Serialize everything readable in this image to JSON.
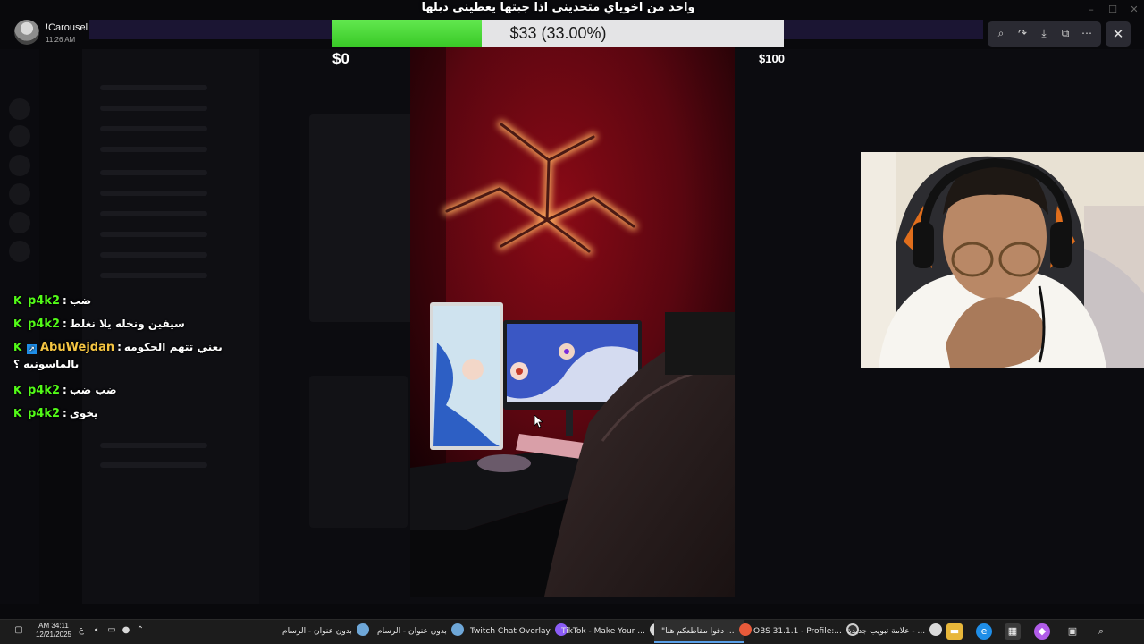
{
  "notification": {
    "title": "!Carousel",
    "time": "11:26 AM"
  },
  "donation_goal": {
    "title": "واحد من اخوياي متحديني اذا جبتها يعطيني دبلها",
    "amount_text": "$33 (33.00%)",
    "progress": 0.33,
    "min_label": "$0",
    "max_label": "$100",
    "fill_color": "#4fd93b"
  },
  "viewer_toolbar": {
    "icons": [
      "zoom-icon",
      "rotate-icon",
      "download-icon",
      "open-external-icon",
      "more-icon"
    ],
    "close_icon": "close-icon"
  },
  "chat": {
    "platform_badge_color": "#53fc18",
    "messages": [
      {
        "user": "p4k2",
        "separator": ":",
        "text": "ضب"
      },
      {
        "user": "p4k2",
        "separator": ":",
        "text": "سيفين ونخله يلا نغلط"
      },
      {
        "user": "AbuWejdan",
        "separator": ":",
        "text": "يعني تتهم الحكومه",
        "continuation": "بالماسونيه ؟"
      },
      {
        "user": "p4k2",
        "separator": ":",
        "text": "ضب ضب"
      },
      {
        "user": "p4k2",
        "separator": ":",
        "text": "يخوي"
      }
    ]
  },
  "taskbar": {
    "clock_time": "AM 34:11",
    "clock_date": "12/21/2025",
    "lang": "ع",
    "tasks": [
      {
        "label": "بدون عنوان - الرسام",
        "icon": "paint-icon"
      },
      {
        "label": "بدون عنوان - الرسام",
        "icon": "paint-icon"
      },
      {
        "label": "Twitch Chat Overlay",
        "icon": "twitch-icon"
      },
      {
        "label": "TikTok - Make Your ...",
        "icon": "chrome-icon"
      },
      {
        "label": "\"دفوا مقاطعكم هنا ...",
        "icon": "chrome-icon",
        "active": true
      },
      {
        "label": "OBS 31.1.1 - Profile:...",
        "icon": "obs-icon"
      },
      {
        "label": "علامة تبويب جديدة - ...",
        "icon": "chrome-icon"
      }
    ],
    "pinned": [
      "file-explorer-icon",
      "edge-icon",
      "store-icon",
      "copilot-icon",
      "task-view-icon",
      "search-icon"
    ]
  }
}
